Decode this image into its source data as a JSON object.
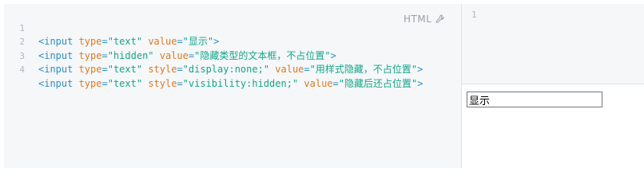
{
  "editor": {
    "language_label": "HTML",
    "lines": [
      {
        "num": "1",
        "open": "<input ",
        "a1": "type",
        "v1": "\"text\"",
        "a2": "value",
        "v2": "\"显示\"",
        "close": ">"
      },
      {
        "num": "2",
        "open": "<input ",
        "a1": "type",
        "v1": "\"hidden\"",
        "a2": "value",
        "v2": "\"隐藏类型的文本框，不占位置\"",
        "close": ">"
      },
      {
        "num": "3",
        "open": "<input ",
        "a1": "type",
        "v1": "\"text\"",
        "a2": "style",
        "v2": "\"display:none;\"",
        "a3": "value",
        "v3": "\"用样式隐藏，不占位置\"",
        "close": ">"
      },
      {
        "num": "4",
        "open": "<input ",
        "a1": "type",
        "v1": "\"text\"",
        "a2": "style",
        "v2": "\"visibility:hidden;\"",
        "a3": "value",
        "v3": "\"隐藏后还占位置\"",
        "close": ">"
      }
    ],
    "icon": "wrench-icon"
  },
  "secondary_editor": {
    "line_number": "1"
  },
  "result": {
    "input_value": "显示"
  },
  "colors": {
    "tag": "#2f8fc1",
    "attribute": "#dd7a1f",
    "string": "#17a58a",
    "background": "#f5f7f9"
  }
}
